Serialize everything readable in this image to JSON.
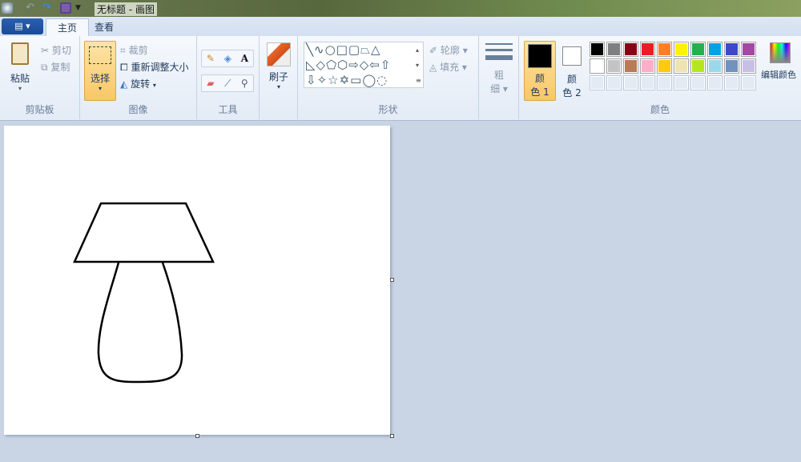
{
  "title": "无标题 - 画图",
  "tabs": [
    "主页",
    "查看"
  ],
  "clipboard": {
    "paste": "粘贴",
    "cut": "剪切",
    "copy": "复制",
    "label": "剪贴板"
  },
  "image": {
    "select": "选择",
    "crop": "裁剪",
    "resize": "重新调整大小",
    "rotate": "旋转",
    "label": "图像"
  },
  "tools": {
    "label": "工具"
  },
  "brushes": {
    "label": "刷子"
  },
  "shapes": {
    "outline": "轮廓",
    "fill": "填充",
    "label": "形状"
  },
  "size": {
    "line1": "粗",
    "line2": "细"
  },
  "colors": {
    "color1_a": "颜",
    "color1_b": "色 1",
    "color2_a": "颜",
    "color2_b": "色 2",
    "edit": "编辑颜色",
    "label": "颜色",
    "color1": "#000000",
    "color2": "#ffffff",
    "palette_row1": [
      "#000000",
      "#7f7f7f",
      "#880015",
      "#ed1c24",
      "#ff7f27",
      "#fff200",
      "#22b14c",
      "#00a2e8",
      "#3f48cc",
      "#a349a4"
    ],
    "palette_row2": [
      "#ffffff",
      "#c3c3c3",
      "#b97a57",
      "#ffaec9",
      "#ffc90e",
      "#efe4b0",
      "#b5e61d",
      "#99d9ea",
      "#7092be",
      "#c8bfe7"
    ]
  }
}
